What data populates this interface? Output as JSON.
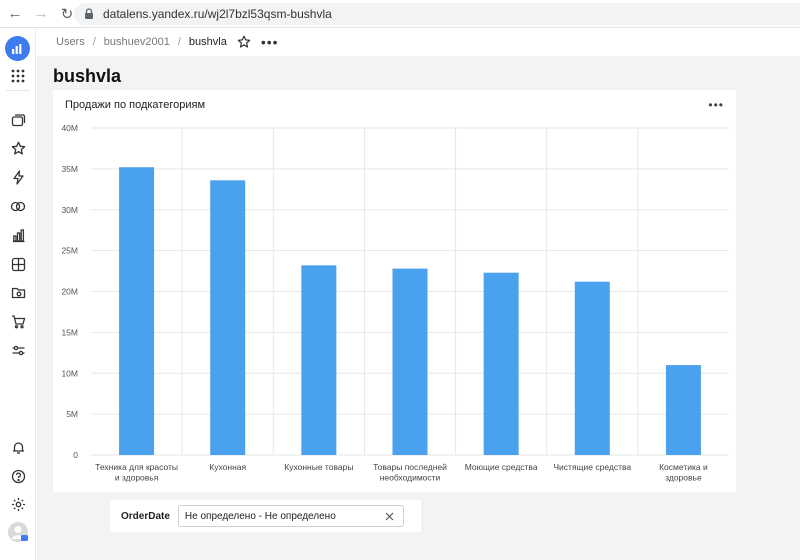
{
  "browser": {
    "url": "datalens.yandex.ru/wj2l7bzl53qsm-bushvla"
  },
  "breadcrumbs": [
    {
      "label": "Users"
    },
    {
      "label": "bushuev2001"
    },
    {
      "label": "bushvla"
    }
  ],
  "dashboard": {
    "title": "bushvla"
  },
  "widget": {
    "title": "Продажи по подкатегориям"
  },
  "filter": {
    "label": "OrderDate",
    "value": "Не определено - Не определено"
  },
  "colors": {
    "bar": "#4aa1ee",
    "brand": "#3f7bf0",
    "grid": "#e6e6e6"
  },
  "rail_icons": [
    "apps-icon",
    "collections-icon",
    "favorites-star-icon",
    "recent-lightning-icon",
    "connections-icon",
    "charts-icon",
    "datasets-table-icon",
    "folder-icon",
    "marketplace-cart-icon",
    "settings-sliders-icon",
    "notifications-bell-icon",
    "help-icon",
    "settings-gear-icon",
    "user-avatar"
  ],
  "chart_data": {
    "type": "bar",
    "title": "Продажи по подкатегориям",
    "categories": [
      [
        "Техника для красоты",
        "и здоровья"
      ],
      [
        "Кухонная"
      ],
      [
        "Кухонные товары"
      ],
      [
        "Товары последней",
        "необходимости"
      ],
      [
        "Моющие средства"
      ],
      [
        "Чистящие средства"
      ],
      [
        "Косметика и",
        "здоровье"
      ]
    ],
    "values": [
      35200000,
      33600000,
      23200000,
      22800000,
      22300000,
      21200000,
      11000000
    ],
    "ylim": [
      0,
      40000000
    ],
    "yticks": [
      {
        "value": 0,
        "label": "0"
      },
      {
        "value": 5000000,
        "label": "5M"
      },
      {
        "value": 10000000,
        "label": "10M"
      },
      {
        "value": 15000000,
        "label": "15M"
      },
      {
        "value": 20000000,
        "label": "20M"
      },
      {
        "value": 25000000,
        "label": "25M"
      },
      {
        "value": 30000000,
        "label": "30M"
      },
      {
        "value": 35000000,
        "label": "35M"
      },
      {
        "value": 40000000,
        "label": "40M"
      }
    ],
    "grid": true,
    "legend": "none"
  }
}
